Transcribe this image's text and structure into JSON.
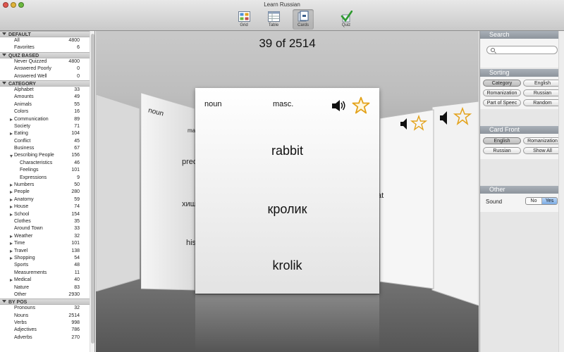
{
  "window": {
    "title": "Learn Russian"
  },
  "toolbar": {
    "items": [
      {
        "label": "Grid",
        "icon": "grid-icon"
      },
      {
        "label": "Table",
        "icon": "table-icon"
      },
      {
        "label": "Cards",
        "icon": "cards-icon",
        "selected": true
      },
      {
        "label": "Quiz",
        "icon": "checkmark-icon"
      }
    ]
  },
  "sidebar": {
    "sections": [
      {
        "title": "DEFAULT",
        "rows": [
          {
            "label": "All",
            "count": "4800"
          },
          {
            "label": "Favorites",
            "count": "6"
          }
        ]
      },
      {
        "title": "QUIZ BASED",
        "rows": [
          {
            "label": "Never Quizzed",
            "count": "4800"
          },
          {
            "label": "Answered Poorly",
            "count": "0"
          },
          {
            "label": "Answered Well",
            "count": "0"
          }
        ]
      },
      {
        "title": "CATEGORY",
        "rows": [
          {
            "label": "Alphabet",
            "count": "33"
          },
          {
            "label": "Amounts",
            "count": "49"
          },
          {
            "label": "Animals",
            "count": "55"
          },
          {
            "label": "Colors",
            "count": "16"
          },
          {
            "label": "Communication",
            "count": "89"
          },
          {
            "label": "Society",
            "count": "71"
          },
          {
            "label": "Eating",
            "count": "104"
          },
          {
            "label": "Conflict",
            "count": "45"
          },
          {
            "label": "Business",
            "count": "67"
          },
          {
            "label": "Describing People",
            "count": "156"
          },
          {
            "label": "Characteristics",
            "count": "46"
          },
          {
            "label": "Feelings",
            "count": "101"
          },
          {
            "label": "Expressions",
            "count": "9"
          },
          {
            "label": "Numbers",
            "count": "50"
          },
          {
            "label": "People",
            "count": "280"
          },
          {
            "label": "Anatomy",
            "count": "59"
          },
          {
            "label": "House",
            "count": "74"
          },
          {
            "label": "School",
            "count": "154"
          },
          {
            "label": "Clothes",
            "count": "35"
          },
          {
            "label": "Around Town",
            "count": "33"
          },
          {
            "label": "Weather",
            "count": "32"
          },
          {
            "label": "Time",
            "count": "101"
          },
          {
            "label": "Travel",
            "count": "138"
          },
          {
            "label": "Shopping",
            "count": "54"
          },
          {
            "label": "Sports",
            "count": "48"
          },
          {
            "label": "Measurements",
            "count": "11"
          },
          {
            "label": "Medical",
            "count": "40"
          },
          {
            "label": "Nature",
            "count": "83"
          },
          {
            "label": "Other",
            "count": "2930"
          }
        ]
      },
      {
        "title": "BY POS",
        "rows": [
          {
            "label": "Pronouns",
            "count": "32"
          },
          {
            "label": "Nouns",
            "count": "2514"
          },
          {
            "label": "Verbs",
            "count": "998"
          },
          {
            "label": "Adjectives",
            "count": "786"
          },
          {
            "label": "Adverbs",
            "count": "270"
          }
        ]
      }
    ]
  },
  "main": {
    "counter": "39 of 2514",
    "card": {
      "part_of_speech": "noun",
      "gender": "masc.",
      "english": "rabbit",
      "russian": "кролик",
      "romanization": "krolik"
    },
    "side_cards": {
      "left_back": "",
      "left_front_pos": "noun",
      "left_front_gender": "ma",
      "left_front_english": "pred",
      "left_front_russian": "хищ",
      "left_front_roman": "his",
      "right_front_english": "at"
    }
  },
  "panel": {
    "search": {
      "title": "Search",
      "placeholder": ""
    },
    "sorting": {
      "title": "Sorting",
      "options": [
        "Category",
        "English",
        "Romanization",
        "Russian",
        "Part of Speec",
        "Random"
      ],
      "selected": "Category"
    },
    "card_front": {
      "title": "Card Front",
      "options": [
        "English",
        "Romanization",
        "Russian",
        "Show All"
      ],
      "selected": "English"
    },
    "other": {
      "title": "Other",
      "sound_label": "Sound",
      "no_label": "No",
      "yes_label": "Yes",
      "sound_value": "Yes"
    }
  },
  "colors": {
    "star": "#e3a21a",
    "panel_header": "#9aa1a9",
    "selected_segment": "#8fb8ea"
  }
}
